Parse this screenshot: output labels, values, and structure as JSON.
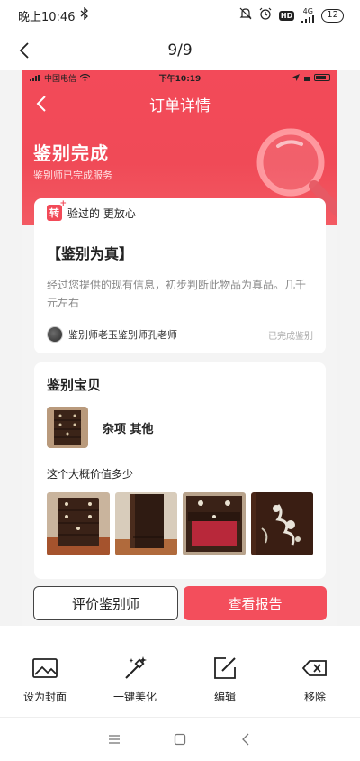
{
  "system_status": {
    "time": "晚上10:46",
    "network": "4G",
    "hd": "HD",
    "battery": "12"
  },
  "viewer": {
    "title": "9/9"
  },
  "inner": {
    "status": {
      "carrier": "中国电信",
      "time": "下午10:19"
    },
    "nav_title": "订单详情",
    "done_title": "鉴别完成",
    "done_sub": "鉴别师已完成服务",
    "verified": {
      "logo": "转",
      "text": "验过的 更放心"
    },
    "result": {
      "title": "【鉴别为真】",
      "description": "经过您提供的现有信息，初步判断此物品为真品。几千元左右",
      "appraiser": "鉴别师老玉鉴别师孔老师",
      "status": "已完成鉴别"
    },
    "item": {
      "heading": "鉴别宝贝",
      "name": "杂项 其他",
      "value_question": "这个大概价值多少"
    },
    "buttons": {
      "rate": "评价鉴别师",
      "report": "查看报告"
    }
  },
  "actions": [
    {
      "label": "设为封面",
      "icon": "image-icon"
    },
    {
      "label": "一键美化",
      "icon": "magic-wand-icon"
    },
    {
      "label": "编辑",
      "icon": "edit-icon"
    },
    {
      "label": "移除",
      "icon": "delete-icon"
    }
  ],
  "colors": {
    "brand_red": "#f34a59",
    "button_red": "#f34e5c"
  }
}
